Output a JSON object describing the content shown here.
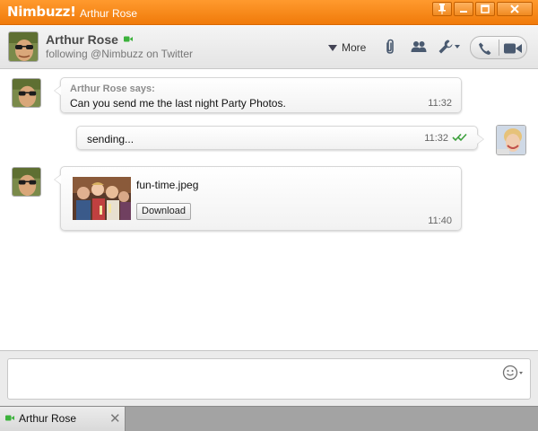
{
  "window": {
    "brand": "Nimbuzz!",
    "title": "Arthur Rose",
    "accent_color": "#f58a1f"
  },
  "header": {
    "contact_name": "Arthur Rose",
    "status": "following @Nimbuzz on Twitter",
    "more_label": "More",
    "icons": [
      "video-status-icon",
      "attach-icon",
      "contacts-icon",
      "settings-icon",
      "phone-icon",
      "video-call-icon"
    ]
  },
  "messages": [
    {
      "sender": "Arthur Rose says:",
      "text": "Can you send me the last night Party Photos.",
      "time": "11:32",
      "side": "left"
    },
    {
      "text": "sending...",
      "time": "11:32",
      "side": "right",
      "status": "delivered-check-icon"
    },
    {
      "file_name": "fun-time.jpeg",
      "button_label": "Download",
      "time": "11:40",
      "side": "left"
    }
  ],
  "input": {
    "value": "",
    "placeholder": ""
  },
  "tabs": [
    {
      "label": "Arthur Rose",
      "close": "✕"
    }
  ]
}
